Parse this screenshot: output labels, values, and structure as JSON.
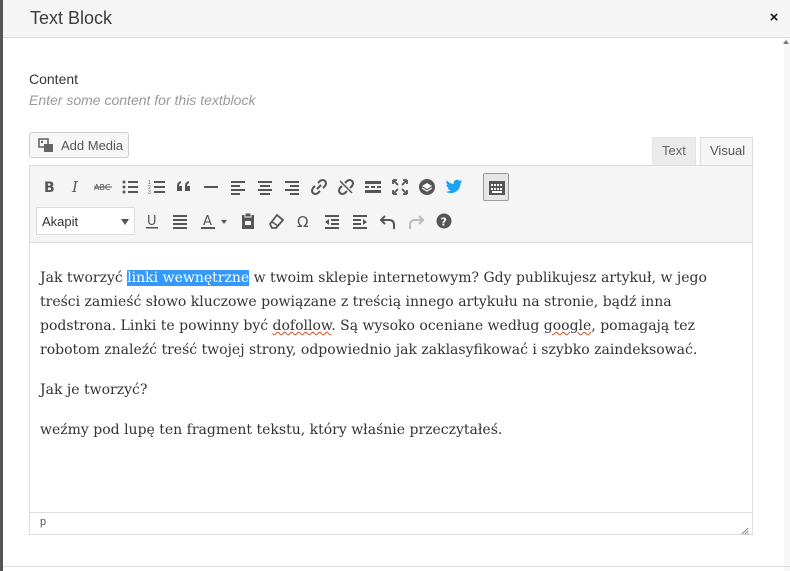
{
  "modal": {
    "title": "Text Block",
    "close_symbol": "×"
  },
  "field": {
    "label": "Content",
    "description": "Enter some content for this textblock"
  },
  "media": {
    "add_media_label": "Add Media"
  },
  "tabs": {
    "text": "Text",
    "visual": "Visual",
    "active": "Visual"
  },
  "toolbar": {
    "format_select": "Akapit",
    "row1_icons": [
      "bold-icon",
      "italic-icon",
      "strikethrough-icon",
      "bullet-list-icon",
      "numbered-list-icon",
      "blockquote-icon",
      "horizontal-rule-icon",
      "align-left-icon",
      "align-center-icon",
      "align-right-icon",
      "link-icon",
      "unlink-icon",
      "read-more-icon",
      "fullscreen-icon",
      "layers-icon",
      "twitter-icon",
      "toolbar-toggle-icon"
    ],
    "row2_icons": [
      "underline-icon",
      "justify-icon",
      "text-color-icon",
      "paste-as-text-icon",
      "clear-formatting-icon",
      "special-character-icon",
      "outdent-icon",
      "indent-icon",
      "undo-icon",
      "redo-icon",
      "help-icon"
    ],
    "bold_glyph": "B",
    "italic_glyph": "I",
    "strike_glyph": "ABC",
    "underline_glyph": "U",
    "textcolor_glyph": "A",
    "omega_glyph": "Ω",
    "help_glyph": "?"
  },
  "content": {
    "p1_before": "Jak tworzyć ",
    "p1_highlight": "linki wewnętrzne",
    "p1_after1": " w twoim sklepie internetowym? Gdy publikujesz artykuł, w jego treści zamieść słowo kluczowe powiązane z treścią innego artykułu na stronie, bądź inna podstrona. Linki te powinny być ",
    "p1_dofollow": "dofollow",
    "p1_after2": ". Są wysoko oceniane według ",
    "p1_google": "google",
    "p1_after3": ", pomagają tez robotom znaleźć treść twojej strony, odpowiednio jak zaklasyfikować i szybko zaindeksować.",
    "p2": "Jak je tworzyć?",
    "p3": "weźmy pod lupę ten fragment tekstu, który właśnie przeczytałeś."
  },
  "statusbar": {
    "path": "p"
  },
  "colors": {
    "selection": "#3399ff",
    "twitter": "#1da1f2",
    "spellcheck": "#d54e21"
  }
}
